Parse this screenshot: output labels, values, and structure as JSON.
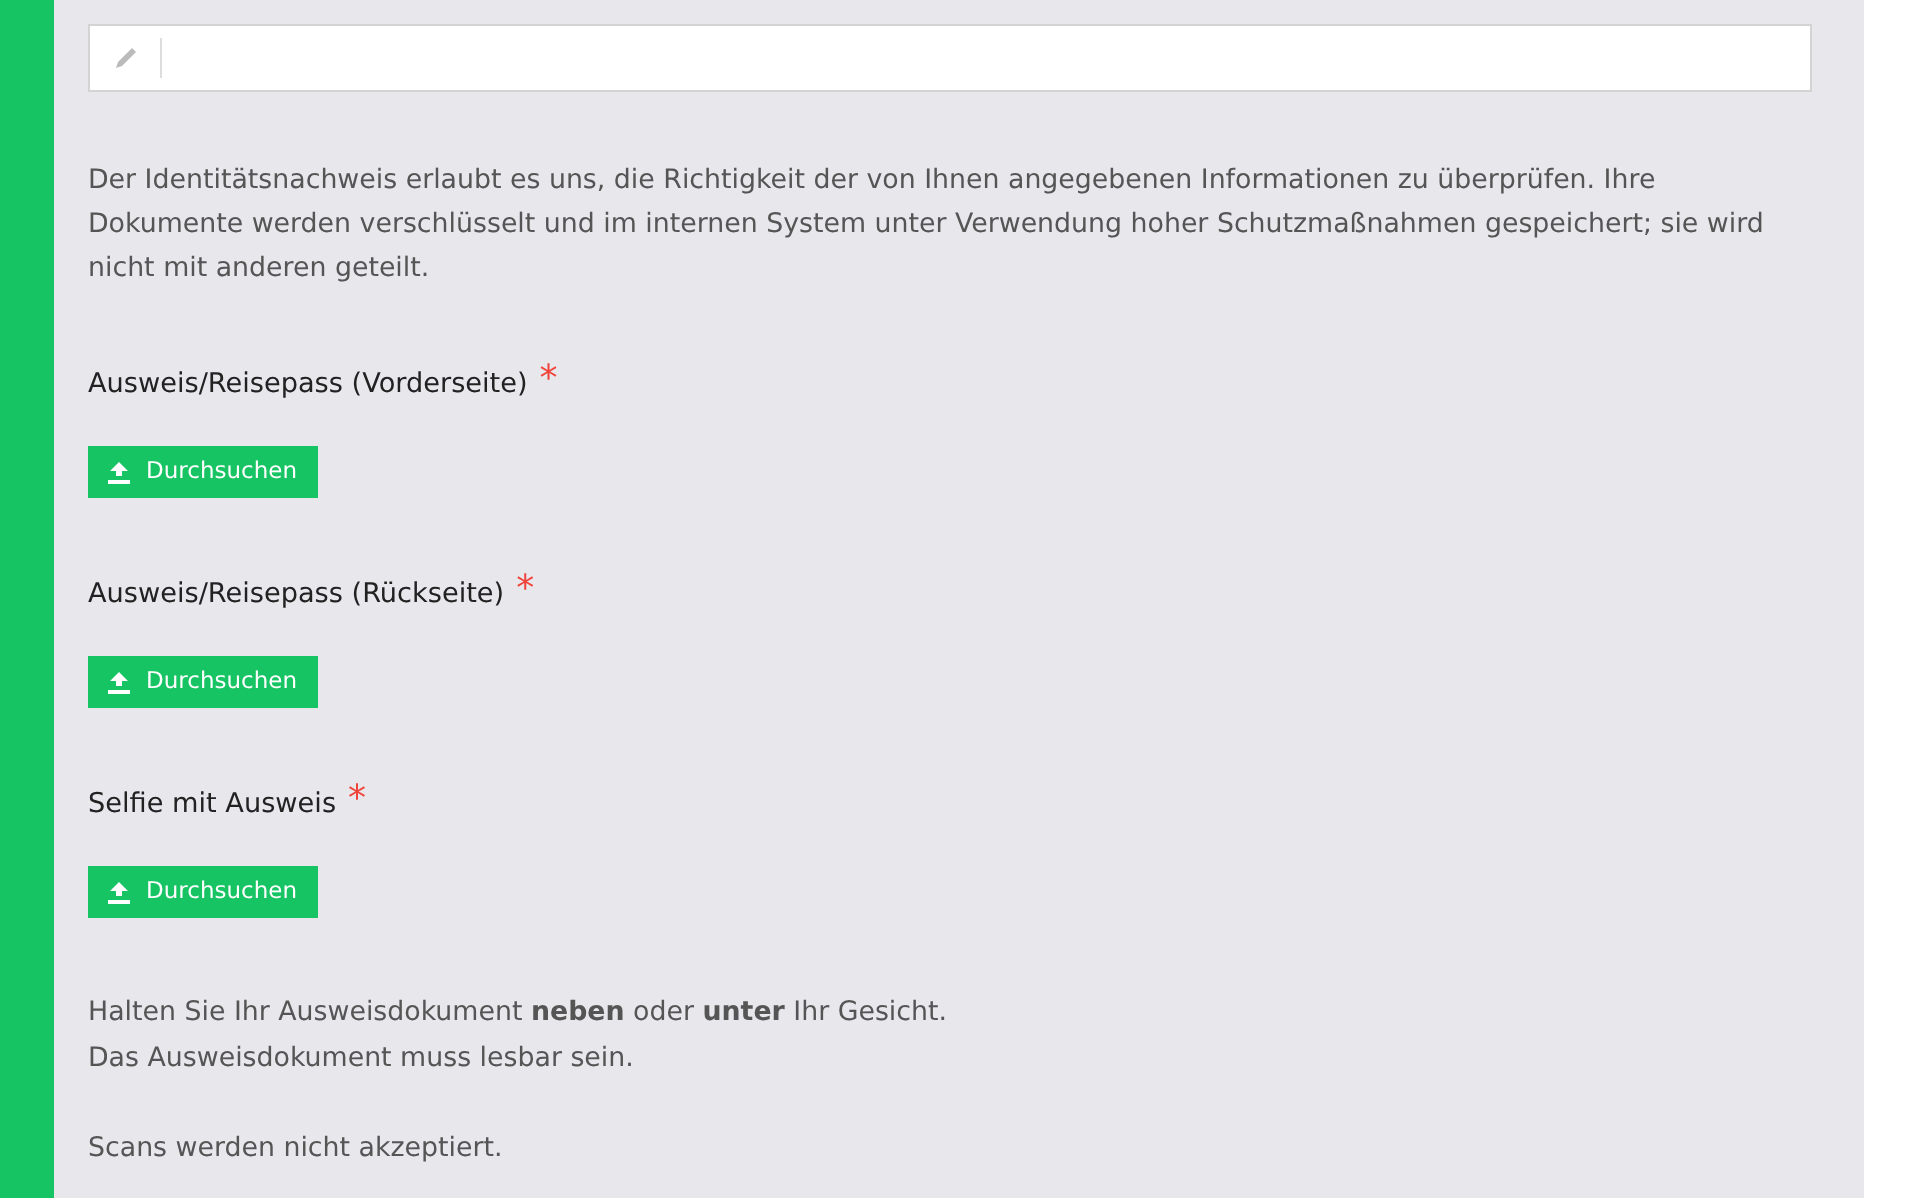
{
  "intro": "Der Identitätsnachweis erlaubt es uns, die Richtigkeit der von Ihnen angegebenen Informationen zu überprüfen. Ihre Dokumente werden verschlüsselt und im internen System unter Verwendung hoher Schutzmaßnahmen gespeichert; sie wird nicht mit anderen geteilt.",
  "uploads": [
    {
      "label": "Ausweis/Reisepass (Vorderseite)",
      "required_mark": "*",
      "button": "Durchsuchen"
    },
    {
      "label": "Ausweis/Reisepass (Rückseite)",
      "required_mark": "*",
      "button": "Durchsuchen"
    },
    {
      "label": "Selfie mit Ausweis",
      "required_mark": "*",
      "button": "Durchsuchen"
    }
  ],
  "note_paragraphs": [
    [
      "Halten Sie Ihr Ausweisdokument **neben** oder **unter** Ihr Gesicht.",
      "Das Ausweisdokument muss lesbar sein."
    ],
    [
      "Scans werden nicht akzeptiert."
    ]
  ]
}
